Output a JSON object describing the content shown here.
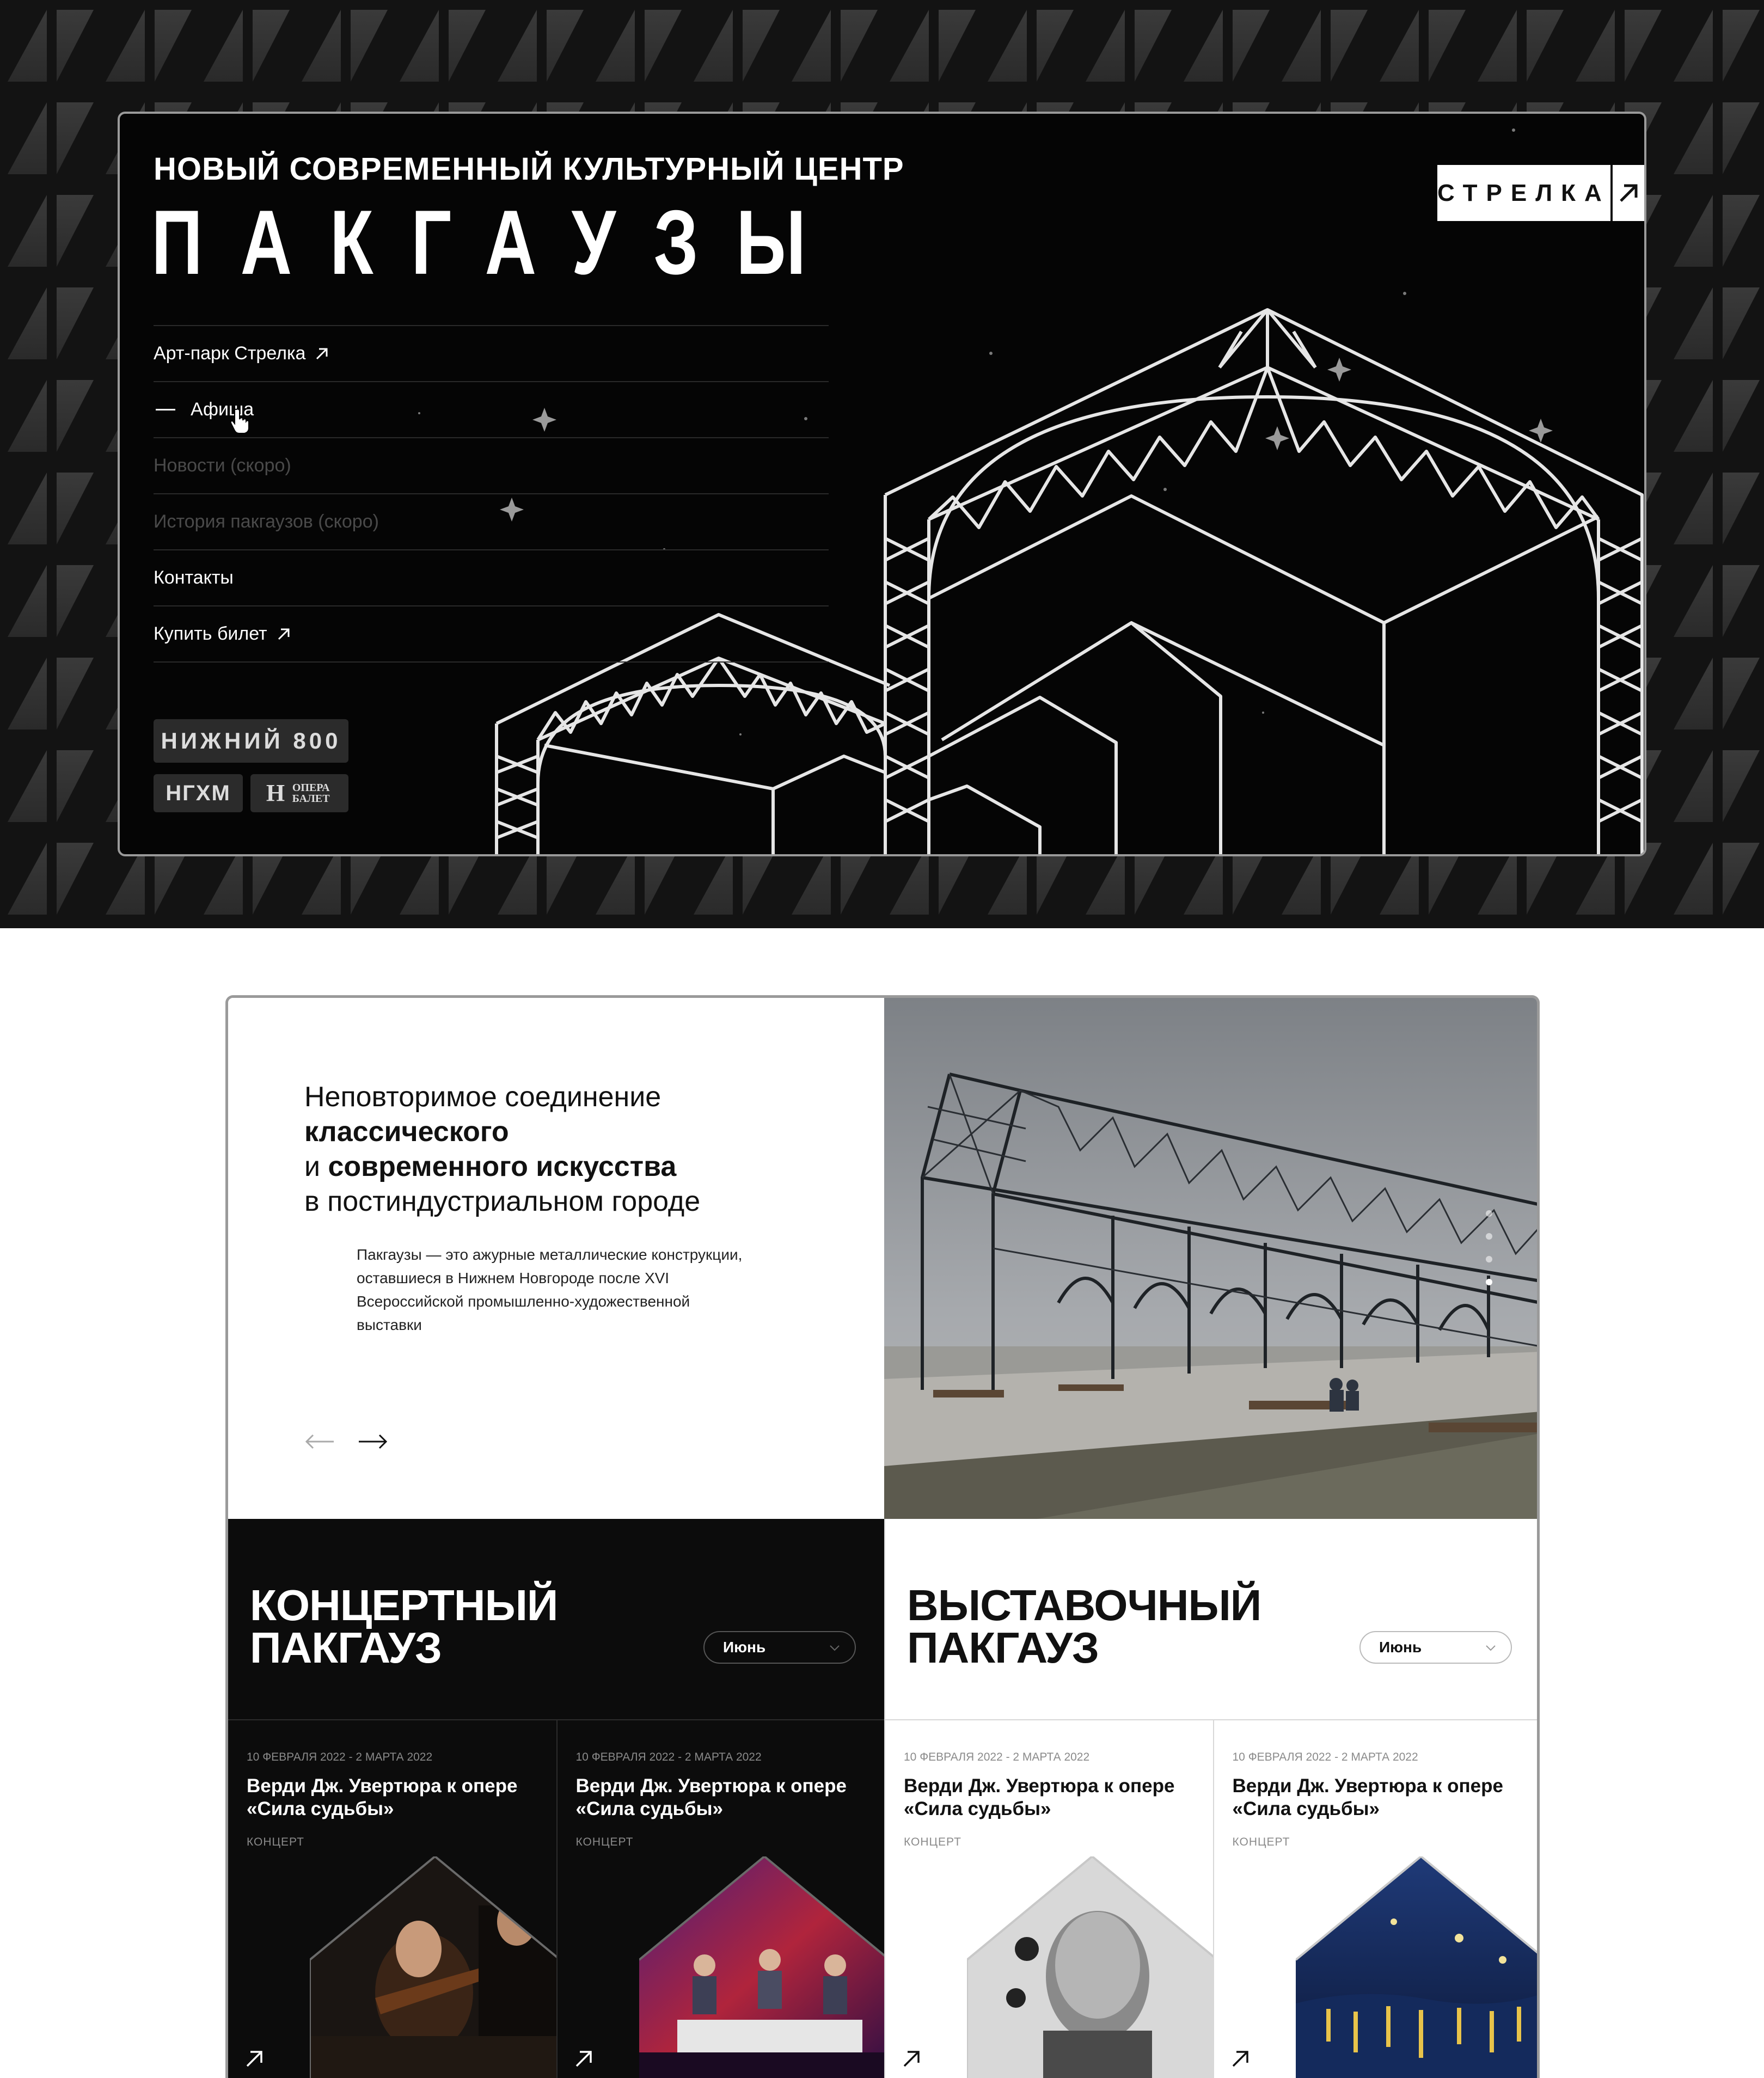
{
  "hero": {
    "subtitle": "НОВЫЙ СОВРЕМЕННЫЙ КУЛЬТУРНЫЙ ЦЕНТР",
    "title": "ПАКГАУЗЫ",
    "strelka_badge": "СТРЕЛКА",
    "nav": [
      {
        "label": "Арт-парк Стрелка",
        "state": "external"
      },
      {
        "label": "Афиша",
        "state": "active"
      },
      {
        "label": "Новости  (скоро)",
        "state": "disabled"
      },
      {
        "label": "История пакгаузов (скоро)",
        "state": "disabled"
      },
      {
        "label": "Контакты",
        "state": "normal"
      },
      {
        "label": "Купить билет",
        "state": "external"
      }
    ],
    "partners": [
      "НИЖНИЙ 800",
      "НГХМ",
      "ОПЕРА БАЛЕТ"
    ]
  },
  "intro": {
    "headline_line1": "Неповторимое соединение",
    "headline_bold1": "классического",
    "headline_line3_prefix": "и ",
    "headline_bold2": "современного искусства",
    "headline_line4": "в постиндустриальном городе",
    "body": "Пакгаузы — это ажурные металлические конструкции, оставшиеся в Нижнем Новгороде после XVI Всероссийской промышленно-художественной выставки"
  },
  "venues": [
    {
      "title_line1": "КОНЦЕРТНЫЙ",
      "title_line2": "ПАКГАУЗ",
      "month": "Июнь",
      "cards": [
        {
          "date": "10 ФЕВРАЛЯ 2022 - 2 МАРТА 2022",
          "title": "Верди Дж. Увертюра к опере «Сила судьбы»",
          "tag": "КОНЦЕРТ"
        },
        {
          "date": "10 ФЕВРАЛЯ 2022 - 2 МАРТА 2022",
          "title": "Верди Дж. Увертюра к опере «Сила судьбы»",
          "tag": "КОНЦЕРТ"
        }
      ]
    },
    {
      "title_line1": "ВЫСТАВОЧНЫЙ",
      "title_line2": "ПАКГАУЗ",
      "month": "Июнь",
      "cards": [
        {
          "date": "10 ФЕВРАЛЯ 2022 - 2 МАРТА 2022",
          "title": "Верди Дж. Увертюра к опере «Сила судьбы»",
          "tag": "КОНЦЕРТ"
        },
        {
          "date": "10 ФЕВРАЛЯ 2022 - 2 МАРТА 2022",
          "title": "Верди Дж. Увертюра к опере «Сила судьбы»",
          "tag": "КОНЦЕРТ"
        }
      ]
    }
  ],
  "colors": {
    "dark": "#0c0c0c",
    "light": "#ffffff",
    "accent": "#ffffff",
    "muted": "#8a8a8a"
  }
}
